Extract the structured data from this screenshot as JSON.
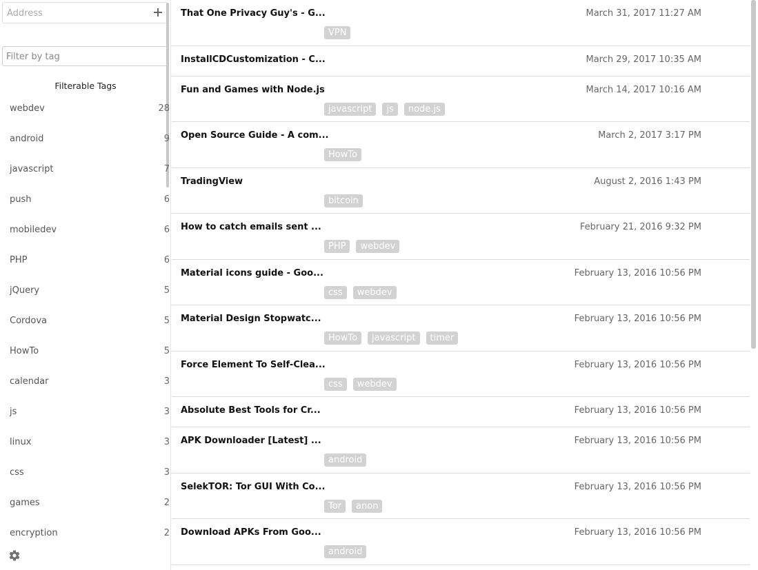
{
  "sidebar": {
    "address_placeholder": "Address",
    "add_icon": "plus-icon",
    "filter_placeholder": "Filter by tag",
    "tags_title": "Filterable Tags",
    "tags": [
      {
        "name": "webdev",
        "count": "28"
      },
      {
        "name": "android",
        "count": "9"
      },
      {
        "name": "javascript",
        "count": "7"
      },
      {
        "name": "push",
        "count": "6"
      },
      {
        "name": "mobiledev",
        "count": "6"
      },
      {
        "name": "PHP",
        "count": "6"
      },
      {
        "name": "jQuery",
        "count": "5"
      },
      {
        "name": "Cordova",
        "count": "5"
      },
      {
        "name": "HowTo",
        "count": "5"
      },
      {
        "name": "calendar",
        "count": "3"
      },
      {
        "name": "js",
        "count": "3"
      },
      {
        "name": "linux",
        "count": "3"
      },
      {
        "name": "css",
        "count": "3"
      },
      {
        "name": "games",
        "count": "2"
      },
      {
        "name": "encryption",
        "count": "2"
      }
    ],
    "settings_icon": "gear-icon"
  },
  "bookmarks": [
    {
      "title": "That One Privacy Guy's - G...",
      "date": "March 31, 2017 11:27 AM",
      "tags": [
        "VPN"
      ]
    },
    {
      "title": "InstallCDCustomization - C...",
      "date": "March 29, 2017 10:35 AM",
      "tags": []
    },
    {
      "title": "Fun and Games with Node.js",
      "date": "March 14, 2017 10:16 AM",
      "tags": [
        "javascript",
        "js",
        "node.js"
      ]
    },
    {
      "title": "Open Source Guide - A com...",
      "date": "March 2, 2017 3:17 PM",
      "tags": [
        "HowTo"
      ]
    },
    {
      "title": "TradingView",
      "date": "August 2, 2016 1:43 PM",
      "tags": [
        "bitcoin"
      ]
    },
    {
      "title": "How to catch emails sent ...",
      "date": "February 21, 2016 9:32 PM",
      "tags": [
        "PHP",
        "webdev"
      ]
    },
    {
      "title": "Material icons guide - Goo...",
      "date": "February 13, 2016 10:56 PM",
      "tags": [
        "css",
        "webdev"
      ]
    },
    {
      "title": "Material Design Stopwatc...",
      "date": "February 13, 2016 10:56 PM",
      "tags": [
        "HowTo",
        "javascript",
        "timer"
      ]
    },
    {
      "title": "Force Element To Self-Clea...",
      "date": "February 13, 2016 10:56 PM",
      "tags": [
        "css",
        "webdev"
      ]
    },
    {
      "title": "Absolute Best Tools for Cr...",
      "date": "February 13, 2016 10:56 PM",
      "tags": []
    },
    {
      "title": "APK Downloader [Latest] ...",
      "date": "February 13, 2016 10:56 PM",
      "tags": [
        "android"
      ]
    },
    {
      "title": "SelekTOR: Tor GUI With Co...",
      "date": "February 13, 2016 10:56 PM",
      "tags": [
        "Tor",
        "anon"
      ]
    },
    {
      "title": "Download APKs From Goo...",
      "date": "February 13, 2016 10:56 PM",
      "tags": [
        "android"
      ]
    }
  ]
}
